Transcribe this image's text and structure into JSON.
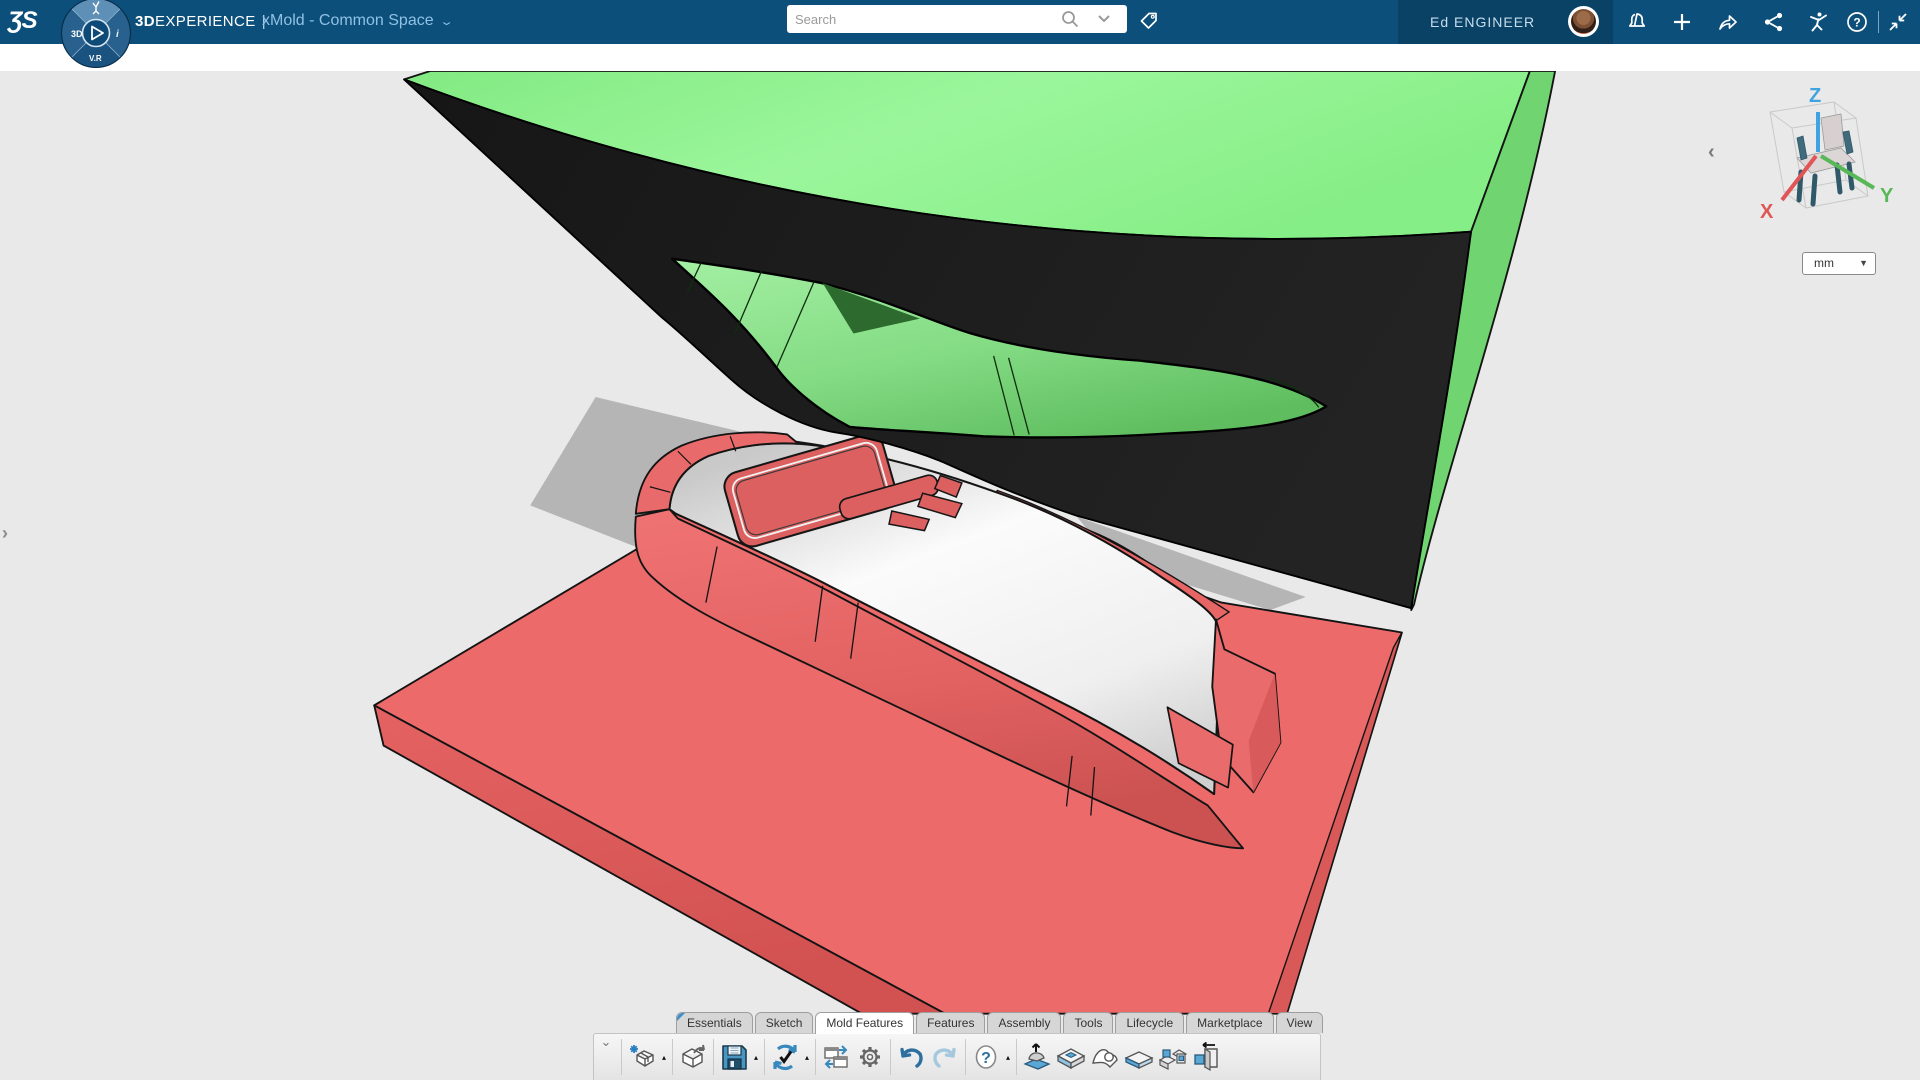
{
  "app_bar": {
    "logo_text": "ƷS",
    "brand_bold": "3D",
    "brand_rest": "EXPERIENCE",
    "brand_divider": "|",
    "workspace_title": "xMold - Common Space",
    "workspace_caret": "⌄",
    "search_placeholder": "Search",
    "user_name": "Ed ENGINEER"
  },
  "compass": {
    "west_label": "3D",
    "east_label": "i",
    "south_label": "V.R"
  },
  "viewport": {
    "units_value": "mm",
    "units_caret": "▼",
    "axis_x": "X",
    "axis_y": "Y",
    "axis_z": "Z",
    "left_expander_glyph": "›",
    "right_expander_glyph": "‹"
  },
  "ribbon": {
    "tabs": [
      {
        "label": "Essentials"
      },
      {
        "label": "Sketch"
      },
      {
        "label": "Mold Features"
      },
      {
        "label": "Features"
      },
      {
        "label": "Assembly"
      },
      {
        "label": "Tools"
      },
      {
        "label": "Lifecycle"
      },
      {
        "label": "Marketplace"
      },
      {
        "label": "View"
      }
    ],
    "active_tab": "Mold Features",
    "handle_glyph": "⌄",
    "dropdown_glyph": "▴",
    "help_glyph": "?",
    "toolbar_icon_names": [
      "new-content-icon",
      "import-icon",
      "save-icon",
      "update-sync-icon",
      "paste-special-icon",
      "settings-gear-icon",
      "undo-icon",
      "redo-icon",
      "help-icon",
      "extract-core-cavity-icon",
      "cavity-plate-icon",
      "parting-surface-icon",
      "core-plate-icon",
      "mold-base-icon",
      "mold-insert-icon"
    ]
  },
  "scene": {
    "colors": {
      "cavity_block_top": "#8cef8c",
      "cavity_block_side": "#70d470",
      "block_underside": "#1b1b1b",
      "cavity_interior": "#7fd47f",
      "core_plate_top": "#ec6a6a",
      "core_plate_side": "#dd5b5b",
      "part_body": "#f2f2f2",
      "part_trim": "#dc6060",
      "shadow": "#b5b5b5",
      "background": "#e9e9e9"
    }
  }
}
